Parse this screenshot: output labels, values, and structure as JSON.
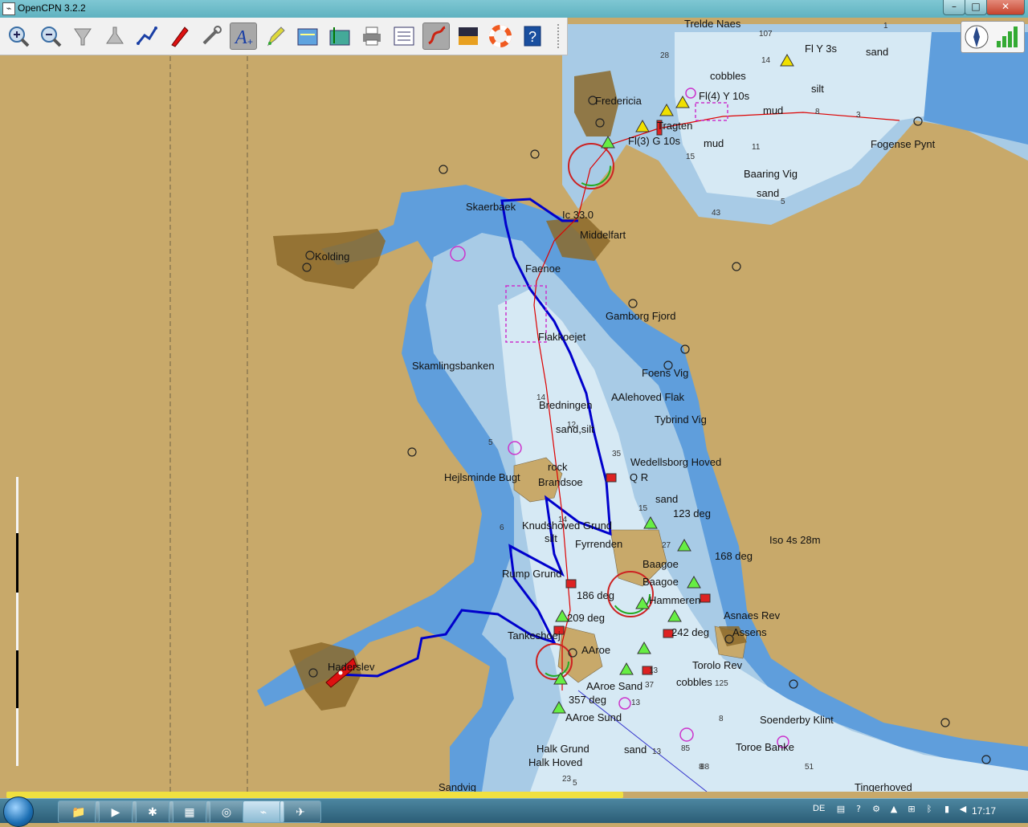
{
  "window": {
    "title": "OpenCPN 3.2.2",
    "app_icon": "opencpn-icon"
  },
  "toolbar": {
    "buttons": [
      {
        "name": "zoom-in",
        "glyph": "+"
      },
      {
        "name": "zoom-out",
        "glyph": "−"
      },
      {
        "name": "scale-in",
        "glyph": "▼"
      },
      {
        "name": "scale-out",
        "glyph": "▲"
      },
      {
        "name": "route",
        "glyph": "route"
      },
      {
        "name": "auto-follow",
        "glyph": "ship"
      },
      {
        "name": "settings",
        "glyph": "wrench"
      },
      {
        "name": "text",
        "glyph": "A"
      },
      {
        "name": "current-tide",
        "glyph": "pen"
      },
      {
        "name": "tides",
        "glyph": "tide"
      },
      {
        "name": "currents",
        "glyph": "current"
      },
      {
        "name": "print",
        "glyph": "print"
      },
      {
        "name": "route-manager",
        "glyph": "list"
      },
      {
        "name": "track",
        "glyph": "track"
      },
      {
        "name": "color-scheme",
        "glyph": "sun"
      },
      {
        "name": "mob",
        "glyph": "ring"
      },
      {
        "name": "help",
        "glyph": "?"
      }
    ],
    "active_index": 7
  },
  "map": {
    "place_labels": [
      {
        "text": "Trelde Naes"
      },
      {
        "text": "Fl Y 3s"
      },
      {
        "text": "sand"
      },
      {
        "text": "cobbles"
      },
      {
        "text": "silt"
      },
      {
        "text": "Fredericia"
      },
      {
        "text": "Fl(4) Y 10s"
      },
      {
        "text": "mud"
      },
      {
        "text": "Fl(3) G 10s"
      },
      {
        "text": "Tragten"
      },
      {
        "text": "mud"
      },
      {
        "text": "Fogense Pynt"
      },
      {
        "text": "Baaring Vig"
      },
      {
        "text": "sand"
      },
      {
        "text": "Skaerbaek"
      },
      {
        "text": "Middelfart"
      },
      {
        "text": "Kolding"
      },
      {
        "text": "Faenoe"
      },
      {
        "text": "Gamborg Fjord"
      },
      {
        "text": "Flakkoejet"
      },
      {
        "text": "Skamlingsbanken"
      },
      {
        "text": "Foens Vig"
      },
      {
        "text": "AAlehoved Flak"
      },
      {
        "text": "Bredningen"
      },
      {
        "text": "Tybrind Vig"
      },
      {
        "text": "sand,silt"
      },
      {
        "text": "Wedellsborg Hoved"
      },
      {
        "text": "rock"
      },
      {
        "text": "Q R"
      },
      {
        "text": "Brandsoe"
      },
      {
        "text": "Hejlsminde Bugt"
      },
      {
        "text": "sand"
      },
      {
        "text": "123 deg"
      },
      {
        "text": "Knudshoved Grund"
      },
      {
        "text": "Iso 4s 28m"
      },
      {
        "text": "silt"
      },
      {
        "text": "Fyrrenden"
      },
      {
        "text": "168 deg"
      },
      {
        "text": "Baagoe"
      },
      {
        "text": "Rump Grund"
      },
      {
        "text": "Baagoe"
      },
      {
        "text": "186 deg"
      },
      {
        "text": "Hammeren"
      },
      {
        "text": "209 deg"
      },
      {
        "text": "Asnaes Rev"
      },
      {
        "text": "242 deg"
      },
      {
        "text": "Assens"
      },
      {
        "text": "Tankeshoej"
      },
      {
        "text": "AAroe"
      },
      {
        "text": "Haderslev"
      },
      {
        "text": "Torolo Rev"
      },
      {
        "text": "cobbles"
      },
      {
        "text": "AAroe Sand"
      },
      {
        "text": "357 deg"
      },
      {
        "text": "AAroe Sund"
      },
      {
        "text": "Soenderby Klint"
      },
      {
        "text": "Halk Grund"
      },
      {
        "text": "sand"
      },
      {
        "text": "Toroe Banke"
      },
      {
        "text": "Halk Hoved"
      },
      {
        "text": "Sandvig"
      },
      {
        "text": "Tingerhoved"
      },
      {
        "text": "Ic 33.0"
      }
    ],
    "depth_soundings": [
      "10",
      "7",
      "14",
      "1",
      "28",
      "8",
      "15",
      "11",
      "5",
      "43",
      "3",
      "14",
      "12",
      "35",
      "15",
      "14",
      "13",
      "13",
      "8",
      "5",
      "23",
      "5",
      "51",
      "8",
      "6",
      "125",
      "85",
      "88",
      "27",
      "37",
      "13"
    ],
    "colors": {
      "land": "#c8a96a",
      "urban": "#8c6a2a",
      "deep_water": "#d6e9f4",
      "shallow_water": "#a8cbe6",
      "very_shallow": "#5f9edc",
      "track": "#0000cc",
      "route": "#cc0000"
    }
  },
  "progress": {
    "fraction": 0.6
  },
  "taskbar": {
    "start_label": "Start",
    "tasks": [
      "explorer",
      "media-player",
      "network",
      "calculator",
      "chrome",
      "opencpn",
      "maps"
    ],
    "active_task": 5,
    "language": "DE",
    "clock": "17:17"
  }
}
